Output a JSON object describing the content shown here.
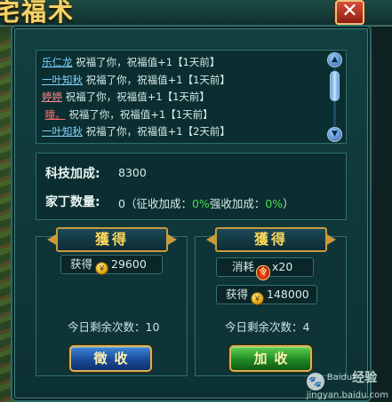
{
  "window": {
    "title_fragment": "宅福术"
  },
  "log": {
    "entries": [
      {
        "name": "乐仁龙",
        "text": "祝福了你，祝福值+1【1天前】",
        "name_color": "blue"
      },
      {
        "name": "一叶知秋",
        "text": "祝福了你，祝福值+1【1天前】",
        "name_color": "blue"
      },
      {
        "name": "婷婷",
        "text": "祝福了你，祝福值+1【1天前】",
        "name_color": "pink"
      },
      {
        "name": "瞳。",
        "text": "祝福了你，祝福值+1【1天前】",
        "name_color": "red"
      },
      {
        "name": "一叶知秋",
        "text": "祝福了你，祝福值+1【2天前】",
        "name_color": "blue"
      }
    ]
  },
  "stats": {
    "tech_label": "科技加成:",
    "tech_value": "8300",
    "servants_label": "家丁数量:",
    "servants_prefix": "0（征收加成：",
    "servants_collect_pct": "0%",
    "servants_mid": "强收加成：",
    "servants_force_pct": "0%",
    "servants_suffix": "）"
  },
  "collect": {
    "ribbon": "獲得",
    "gain_label": "获得",
    "gain_amount": "29600",
    "remaining_label": "今日剩余次数：",
    "remaining_count": "10",
    "button": "徵收"
  },
  "force": {
    "ribbon": "獲得",
    "cost_label": "消耗",
    "cost_amount": "x20",
    "gain_label": "获得",
    "gain_amount": "148000",
    "remaining_label": "今日剩余次数：",
    "remaining_count": "4",
    "button": "加收"
  },
  "watermark": {
    "site": "jingyan.baidu.com",
    "brand": "经验",
    "brand_prefix": "Baidu"
  },
  "colors": {
    "accent": "#ffd95a",
    "green": "#43e04a",
    "panel": "#123f41"
  },
  "icons": {
    "close": "close-icon",
    "coin": "coin-icon",
    "gourd": "gourd-icon",
    "scroll_up": "chevron-up-icon",
    "scroll_down": "chevron-down-icon"
  }
}
